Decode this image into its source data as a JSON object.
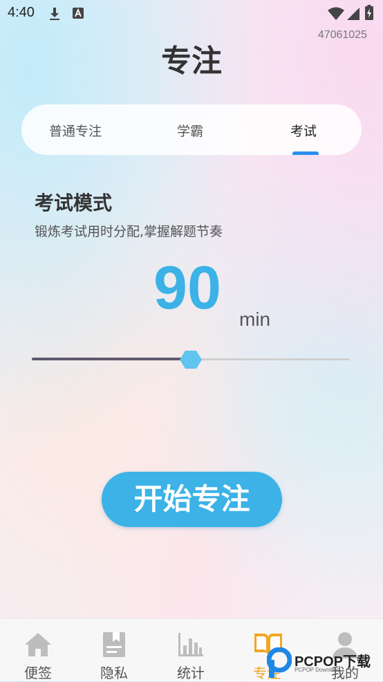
{
  "status_bar": {
    "time": "4:40",
    "icons": [
      "download-icon",
      "text-notification-icon",
      "wifi-icon",
      "signal-icon",
      "battery-charging-icon"
    ]
  },
  "user_id": "47061025",
  "page_title": "专注",
  "tabs": [
    {
      "label": "普通专注",
      "active": false
    },
    {
      "label": "学霸",
      "active": false
    },
    {
      "label": "考试",
      "active": true
    }
  ],
  "mode": {
    "title": "考试模式",
    "description": "锻炼考试用时分配,掌握解题节奏"
  },
  "timer": {
    "minutes": "90",
    "unit": "min",
    "slider_fraction": 0.5
  },
  "start_button_label": "开始专注",
  "bottom_nav": [
    {
      "label": "便签",
      "icon": "home-icon",
      "active": false
    },
    {
      "label": "隐私",
      "icon": "lock-document-icon",
      "active": false
    },
    {
      "label": "统计",
      "icon": "bar-chart-icon",
      "active": false
    },
    {
      "label": "专注",
      "icon": "book-icon",
      "active": true
    },
    {
      "label": "我的",
      "icon": "person-icon",
      "active": false
    }
  ],
  "watermark": {
    "brand": "PCPOP下载",
    "sub": "PCPOP Download"
  },
  "colors": {
    "accent": "#3cb2e6",
    "tab_indicator": "#2b8ef0",
    "nav_active": "#f0a623",
    "nav_inactive_icon": "#bdbdbd"
  }
}
